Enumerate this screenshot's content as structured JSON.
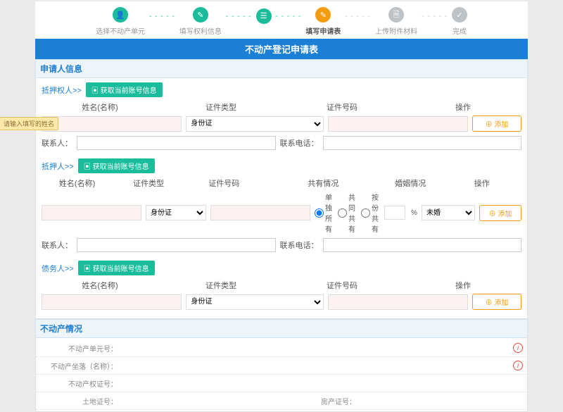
{
  "steps": [
    {
      "label": "选择不动产单元",
      "state": "done",
      "icon": "👤"
    },
    {
      "label": "填写权利信息",
      "state": "done",
      "icon": "✎"
    },
    {
      "label": "",
      "state": "done",
      "icon": "☰"
    },
    {
      "label": "填写申请表",
      "state": "active",
      "icon": "✎"
    },
    {
      "label": "上传附件材料",
      "state": "pending",
      "icon": "🗎"
    },
    {
      "label": "完成",
      "state": "pending",
      "icon": "✓"
    }
  ],
  "title": "不动产登记申请表",
  "s1": {
    "header": "申请人信息"
  },
  "applicant": {
    "label": "抵押权人>>",
    "btn": "▣ 获取当前账号信息",
    "h1": "姓名(名称)",
    "h2": "证件类型",
    "h3": "证件号码",
    "hop": "操作",
    "hint": "请输入填写的姓名",
    "selOpt": "身份证",
    "addBtn": "添加",
    "contact1": "联系人：",
    "contact2": "联系电话："
  },
  "mortgagor": {
    "label": "抵押人>>",
    "btn": "▣ 获取当前账号信息",
    "h1": "姓名(名称)",
    "h2": "证件类型",
    "h3": "证件号码",
    "h4": "共有情况",
    "h5": "婚姻情况",
    "hop": "操作",
    "selOpt": "身份证",
    "r1": "单独所有",
    "r2": "共同共有",
    "r3": "按份共有",
    "pct": "%",
    "sel2": "未婚",
    "addBtn": "添加",
    "contact1": "联系人：",
    "contact2": "联系电话："
  },
  "obligor": {
    "label": "债务人>>",
    "btn": "▣ 获取当前账号信息",
    "h1": "姓名(名称)",
    "h2": "证件类型",
    "h3": "证件号码",
    "hop": "操作",
    "selOpt": "身份证",
    "addBtn": "添加"
  },
  "s2": {
    "header": "不动产情况"
  },
  "prop": {
    "r1": "不动产单元号：",
    "r2": "不动产坐落（名称）：",
    "r3": "不动产权证号：",
    "r4": "土地证号：",
    "r5": "房产证号："
  }
}
